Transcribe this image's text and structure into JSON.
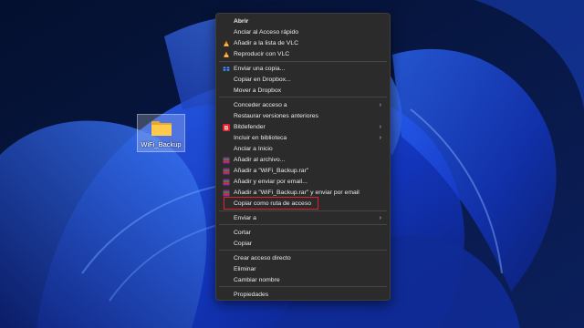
{
  "desktop": {
    "folder_label": "WiFi_Backup"
  },
  "menu": {
    "items": [
      {
        "label": "Abrir",
        "icon": "",
        "arrow": false
      },
      {
        "label": "Anclar al Acceso rápido",
        "icon": "",
        "arrow": false
      },
      {
        "label": "Añadir a la lista de VLC",
        "icon": "vlc-icon",
        "arrow": false
      },
      {
        "label": "Reproducir con VLC",
        "icon": "vlc-icon",
        "arrow": false
      },
      {
        "label": "Enviar una copia...",
        "icon": "dropbox-icon",
        "arrow": false
      },
      {
        "label": "Copiar en Dropbox...",
        "icon": "",
        "arrow": false
      },
      {
        "label": "Mover a Dropbox",
        "icon": "",
        "arrow": false
      },
      {
        "label": "Conceder acceso a",
        "icon": "",
        "arrow": true
      },
      {
        "label": "Restaurar versiones anteriores",
        "icon": "",
        "arrow": false
      },
      {
        "label": "Bitdefender",
        "icon": "bitdefender-icon",
        "arrow": true
      },
      {
        "label": "Incluir en biblioteca",
        "icon": "",
        "arrow": true
      },
      {
        "label": "Anclar a Inicio",
        "icon": "",
        "arrow": false
      },
      {
        "label": "Añadir al archivo...",
        "icon": "winrar-icon",
        "arrow": false
      },
      {
        "label": "Añadir a \"WiFi_Backup.rar\"",
        "icon": "winrar-icon",
        "arrow": false
      },
      {
        "label": "Añadir y enviar por email...",
        "icon": "winrar-icon",
        "arrow": false
      },
      {
        "label": "Añadir a \"WiFi_Backup.rar\" y enviar por email",
        "icon": "winrar-icon",
        "arrow": false
      },
      {
        "label": "Copiar como ruta de acceso",
        "icon": "",
        "arrow": false
      },
      {
        "label": "Enviar a",
        "icon": "",
        "arrow": true
      },
      {
        "label": "Cortar",
        "icon": "",
        "arrow": false
      },
      {
        "label": "Copiar",
        "icon": "",
        "arrow": false
      },
      {
        "label": "Crear acceso directo",
        "icon": "",
        "arrow": false
      },
      {
        "label": "Eliminar",
        "icon": "",
        "arrow": false
      },
      {
        "label": "Cambiar nombre",
        "icon": "",
        "arrow": false
      },
      {
        "label": "Propiedades",
        "icon": "",
        "arrow": false
      }
    ],
    "arrow_glyph": "›"
  },
  "colors": {
    "highlight_border": "#e0222e",
    "menu_bg": "#2b2b2b"
  }
}
